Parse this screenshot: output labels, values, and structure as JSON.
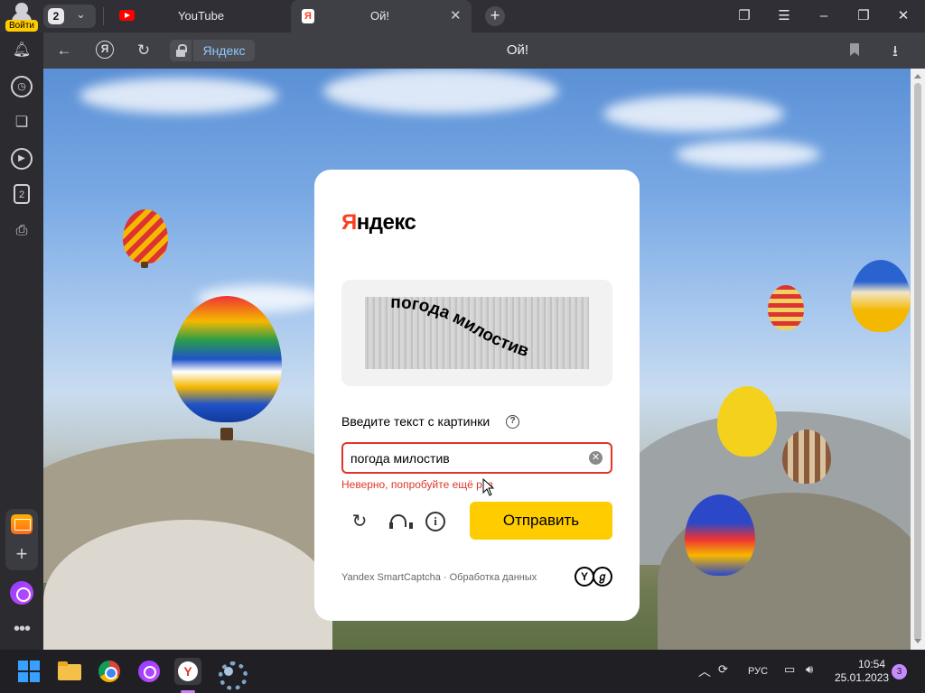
{
  "browser": {
    "profile_login_label": "Войти",
    "tab_count": "2",
    "tabs": [
      {
        "title": "YouTube",
        "icon": "youtube-icon"
      },
      {
        "title": "Ой!",
        "icon": "yandex-favicon",
        "active": true
      }
    ],
    "address_bar": {
      "domain": "Яндекс",
      "page_title": "Ой!"
    },
    "sidebar_badge": "2"
  },
  "captcha": {
    "brand_first_letter": "Я",
    "brand_rest": "ндекс",
    "captcha_text": "погода милостив",
    "prompt": "Введите текст с картинки",
    "input_value": "погода милостив",
    "error": "Неверно, попробуйте ещё раз",
    "submit_label": "Отправить",
    "footer": "Yandex SmartCaptcha · Обработка данных"
  },
  "taskbar": {
    "language": "РУС",
    "time": "10:54",
    "date": "25.01.2023",
    "notification_count": "3"
  },
  "colors": {
    "brand_red": "#fc3f1d",
    "accent_yellow": "#ffcc00",
    "error_red": "#e0362a"
  }
}
